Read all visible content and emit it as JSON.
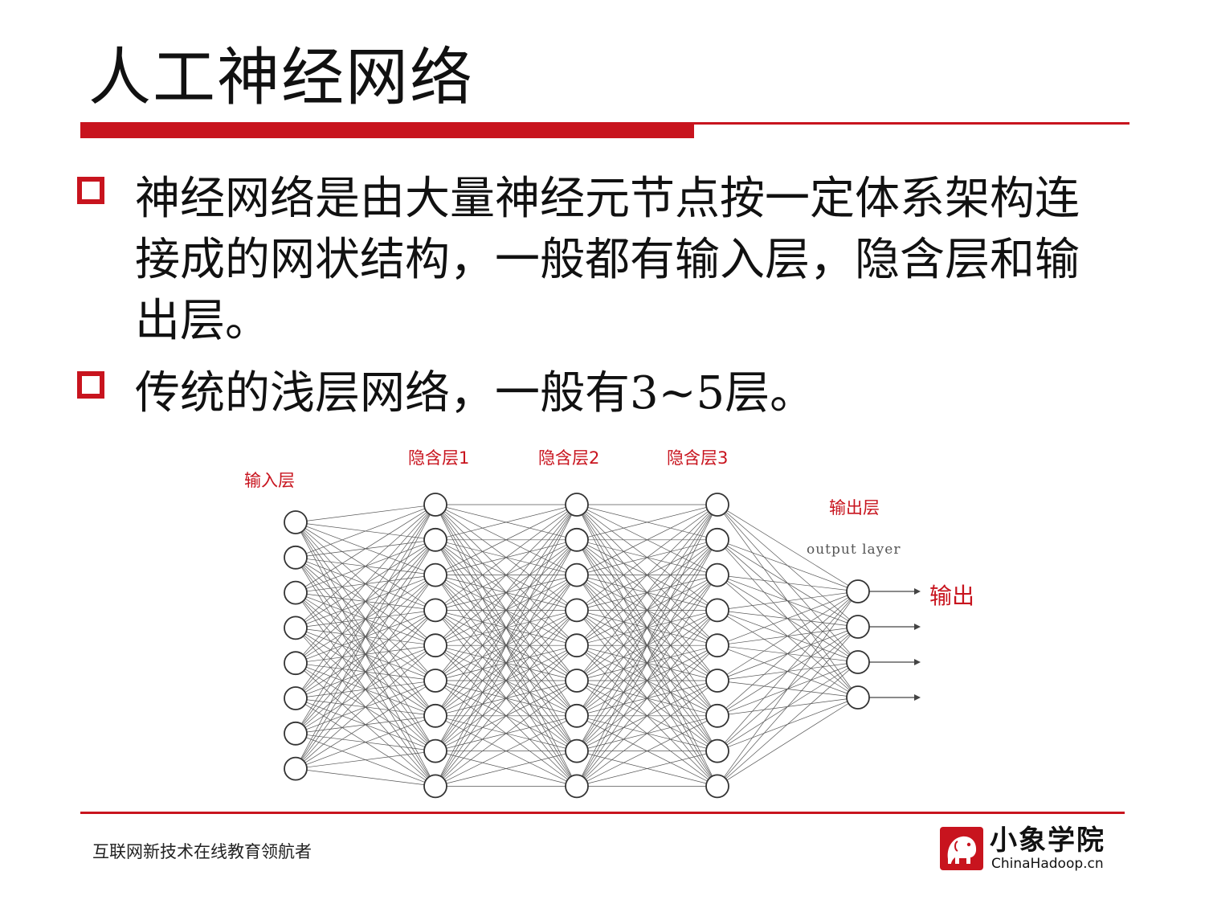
{
  "slide": {
    "title": "人工神经网络",
    "bullets": [
      "神经网络是由大量神经元节点按一定体系架构连接成的网状结构，一般都有输入层，隐含层和输出层。",
      "传统的浅层网络，一般有3~5层。"
    ]
  },
  "diagram": {
    "labels": {
      "input": "输入层",
      "hidden1": "隐含层1",
      "hidden2": "隐含层2",
      "hidden3": "隐含层3",
      "output_cn": "输出层",
      "output_en": "output layer",
      "output_arrow": "输出"
    },
    "layers": [
      {
        "name": "input",
        "nodes": 8
      },
      {
        "name": "hidden1",
        "nodes": 9
      },
      {
        "name": "hidden2",
        "nodes": 9
      },
      {
        "name": "hidden3",
        "nodes": 9
      },
      {
        "name": "output",
        "nodes": 4
      }
    ],
    "node_color": "#333333",
    "edge_color": "#555555"
  },
  "footer": {
    "tagline": "互联网新技术在线教育领航者",
    "logo_brand": "小象学院",
    "logo_url": "ChinaHadoop.cn"
  },
  "colors": {
    "accent": "#c8141e"
  }
}
